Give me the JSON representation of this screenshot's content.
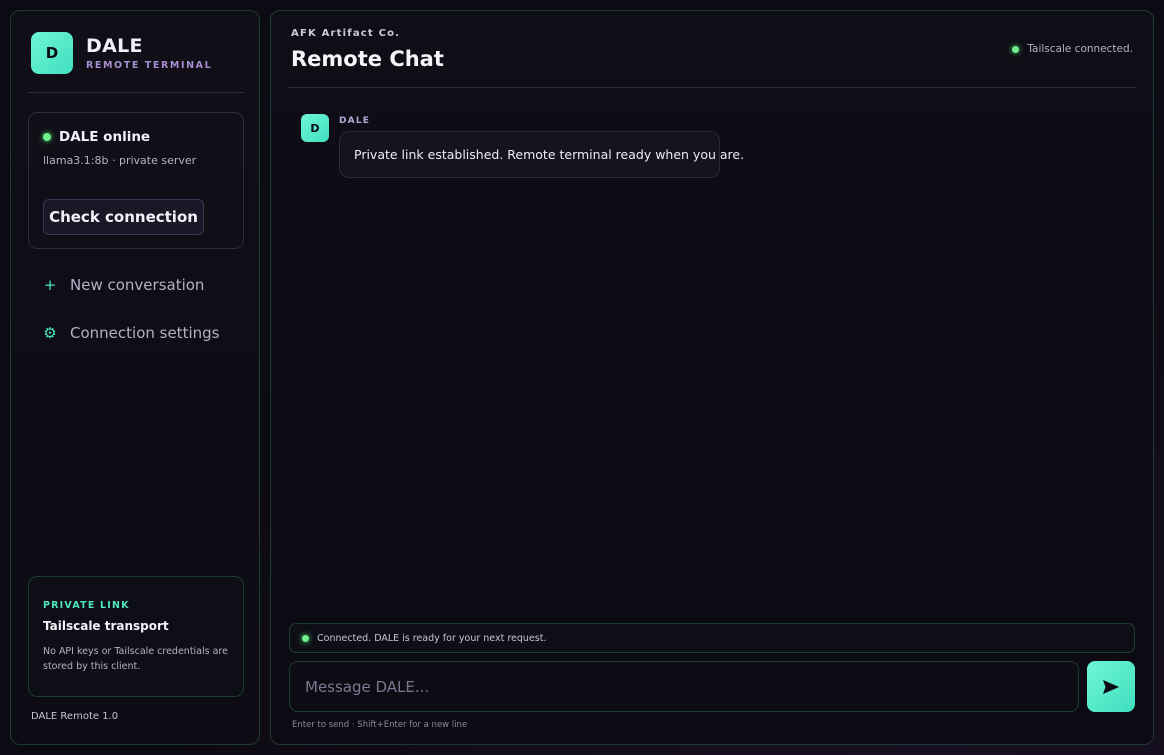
{
  "sidebar": {
    "brand": {
      "logo_letter": "D",
      "name": "DALE",
      "subtitle": "REMOTE TERMINAL"
    },
    "status": {
      "title": "DALE online",
      "model": "llama3.1:8b · private server",
      "check_button": "Check connection",
      "indicator_color": "#6ff08a"
    },
    "nav": [
      {
        "icon": "plus-icon",
        "label": "New conversation"
      },
      {
        "icon": "gear-icon",
        "label": "Connection settings"
      }
    ],
    "private_link": {
      "tag": "PRIVATE LINK",
      "title": "Tailscale transport",
      "description": "No API keys or Tailscale credentials are stored by this client."
    },
    "version": "DALE Remote 1.0"
  },
  "main": {
    "company": "AFK Artifact Co.",
    "title": "Remote Chat",
    "connection_status": "Tailscale connected.",
    "messages": [
      {
        "avatar_letter": "D",
        "sender": "DALE",
        "text": "Private link established. Remote terminal ready when you are."
      }
    ],
    "ready_status": "Connected. DALE is ready for your next request.",
    "input": {
      "placeholder": "Message DALE...",
      "value": ""
    },
    "send_icon": "send-icon",
    "hint": "Enter to send · Shift+Enter for a new line"
  },
  "colors": {
    "accent": "#4fe5c3",
    "accent_light": "#6ff5d6",
    "online": "#6ff08a",
    "background": "#0c0a12",
    "border": "#1f3a36"
  }
}
